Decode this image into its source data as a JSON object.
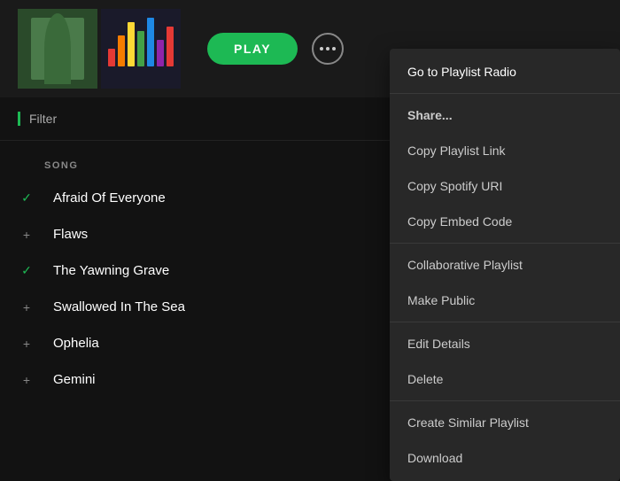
{
  "header": {
    "play_button_label": "PLAY"
  },
  "filter": {
    "label": "Filter"
  },
  "song_list": {
    "column_header": "SONG",
    "songs": [
      {
        "title": "Afraid Of Everyone",
        "icon": "check"
      },
      {
        "title": "Flaws",
        "icon": "plus"
      },
      {
        "title": "The Yawning Grave",
        "icon": "check"
      },
      {
        "title": "Swallowed In The Sea",
        "icon": "plus"
      },
      {
        "title": "Ophelia",
        "icon": "plus"
      },
      {
        "title": "Gemini",
        "icon": "plus"
      }
    ]
  },
  "context_menu": {
    "items": [
      {
        "id": "go-to-playlist-radio",
        "label": "Go to Playlist Radio",
        "section": "main"
      },
      {
        "id": "share",
        "label": "Share...",
        "section": "share",
        "divider_before": true
      },
      {
        "id": "copy-playlist-link",
        "label": "Copy Playlist Link",
        "section": "share"
      },
      {
        "id": "copy-spotify-uri",
        "label": "Copy Spotify URI",
        "section": "share"
      },
      {
        "id": "copy-embed-code",
        "label": "Copy Embed Code",
        "section": "share"
      },
      {
        "id": "collaborative-playlist",
        "label": "Collaborative Playlist",
        "section": "edit",
        "divider_before": true
      },
      {
        "id": "make-public",
        "label": "Make Public",
        "section": "edit"
      },
      {
        "id": "edit-details",
        "label": "Edit Details",
        "section": "manage",
        "divider_before": true
      },
      {
        "id": "delete",
        "label": "Delete",
        "section": "manage"
      },
      {
        "id": "create-similar-playlist",
        "label": "Create Similar Playlist",
        "section": "extra",
        "divider_before": true
      },
      {
        "id": "download",
        "label": "Download",
        "section": "extra"
      }
    ]
  },
  "colors": {
    "green": "#1DB954",
    "dark_bg": "#121212",
    "menu_bg": "#282828"
  }
}
